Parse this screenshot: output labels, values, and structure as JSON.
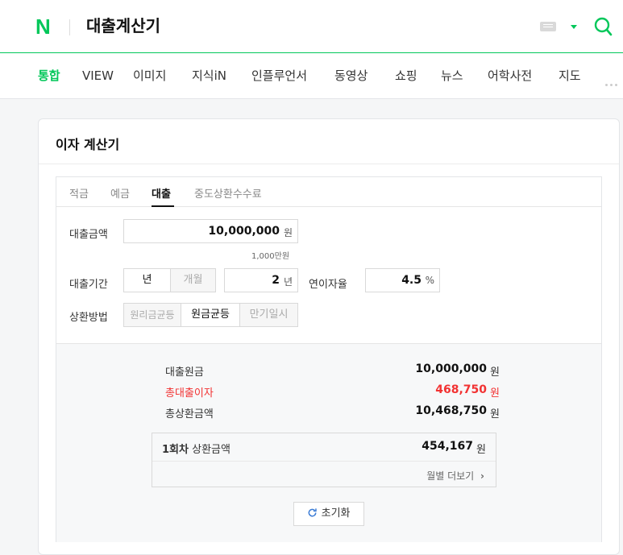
{
  "header": {
    "logo": "N",
    "query": "대출계산기"
  },
  "nav": {
    "items": [
      "통합",
      "VIEW",
      "이미지",
      "지식iN",
      "인플루언서",
      "동영상",
      "쇼핑",
      "뉴스",
      "어학사전",
      "지도"
    ],
    "active_index": 0
  },
  "card": {
    "title": "이자 계산기"
  },
  "tabs": {
    "items": [
      "적금",
      "예금",
      "대출",
      "중도상환수수료"
    ],
    "active_index": 2
  },
  "form": {
    "amount_label": "대출금액",
    "amount_value": "10,000,000",
    "amount_unit": "원",
    "amount_hint": "1,000만원",
    "period_label": "대출기간",
    "period_year": "년",
    "period_month": "개월",
    "period_value": "2",
    "period_unit": "년",
    "rate_label": "연이자율",
    "rate_value": "4.5",
    "rate_unit": "%",
    "method_label": "상환방법",
    "methods": [
      "원리금균등",
      "원금균등",
      "만기일시"
    ],
    "method_selected_index": 1
  },
  "result": {
    "principal_label": "대출원금",
    "principal_value": "10,000,000",
    "interest_label": "총대출이자",
    "interest_value": "468,750",
    "total_label": "총상환금액",
    "total_value": "10,468,750",
    "unit": "원",
    "first_label_bold": "1회차",
    "first_label_rest": "상환금액",
    "first_value": "454,167",
    "more_label": "월별 더보기",
    "reset_label": "초기화"
  },
  "colors": {
    "brand": "#03c75a",
    "red": "#f23232"
  }
}
